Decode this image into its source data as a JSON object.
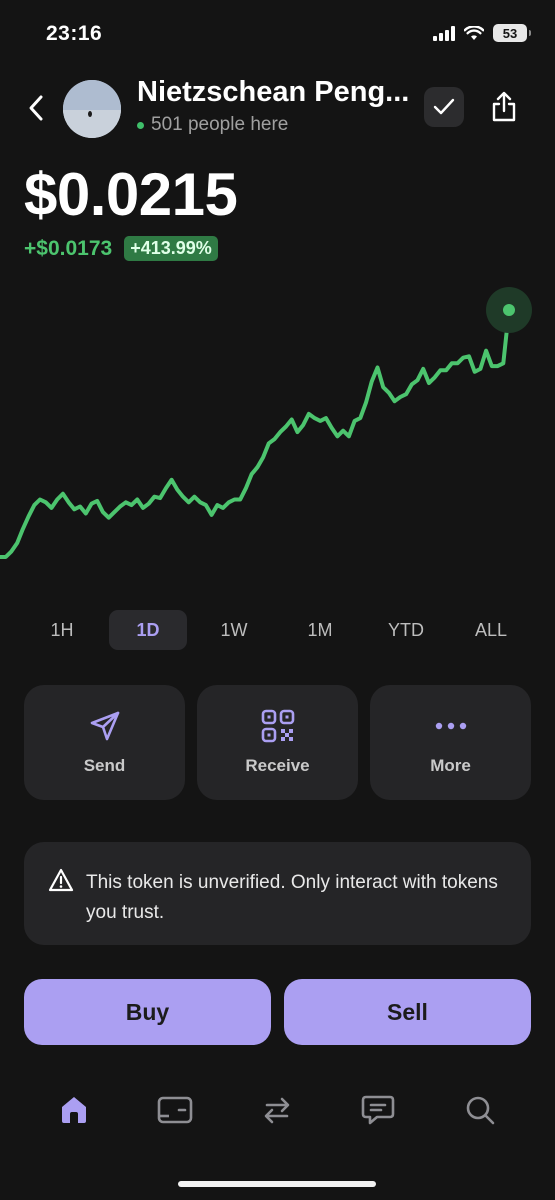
{
  "status_bar": {
    "time": "23:16",
    "battery": "53"
  },
  "token": {
    "name": "Nietzschean Peng...",
    "holders": "501 people here"
  },
  "price": {
    "value": "$0.0215",
    "change_abs": "+$0.0173",
    "change_pct": "+413.99%"
  },
  "colors": {
    "accent": "#ab9ff2",
    "positive": "#4cc46e",
    "background": "#141414",
    "card": "#252527"
  },
  "chart_data": {
    "type": "line",
    "series": [
      {
        "values": [
          0.0042,
          0.0042,
          0.0046,
          0.0052,
          0.0062,
          0.0071,
          0.0079,
          0.0083,
          0.0081,
          0.0077,
          0.0083,
          0.0087,
          0.0081,
          0.0076,
          0.0078,
          0.0073,
          0.008,
          0.0082,
          0.0074,
          0.007,
          0.0074,
          0.0078,
          0.0081,
          0.0079,
          0.0083,
          0.0077,
          0.008,
          0.0085,
          0.0084,
          0.0091,
          0.0097,
          0.009,
          0.0085,
          0.0081,
          0.0085,
          0.0081,
          0.0079,
          0.0072,
          0.0079,
          0.0077,
          0.0081,
          0.0083,
          0.0083,
          0.0091,
          0.0101,
          0.0106,
          0.0113,
          0.0123,
          0.0126,
          0.0131,
          0.0135,
          0.014,
          0.0131,
          0.0136,
          0.0144,
          0.0141,
          0.0139,
          0.0141,
          0.0134,
          0.0128,
          0.0132,
          0.0128,
          0.0139,
          0.0141,
          0.0152,
          0.0167,
          0.0177,
          0.0163,
          0.0159,
          0.0153,
          0.0156,
          0.0158,
          0.0165,
          0.0168,
          0.0176,
          0.0166,
          0.017,
          0.0175,
          0.0175,
          0.018,
          0.018,
          0.0184,
          0.0185,
          0.0174,
          0.0176,
          0.0189,
          0.0178,
          0.0178,
          0.018,
          0.0218
        ]
      }
    ]
  },
  "ranges": [
    "1H",
    "1D",
    "1W",
    "1M",
    "YTD",
    "ALL"
  ],
  "active_range": "1D",
  "actions": {
    "send": "Send",
    "receive": "Receive",
    "more": "More"
  },
  "warning": {
    "text": "This token is unverified. Only interact with tokens you trust."
  },
  "trade": {
    "buy": "Buy",
    "sell": "Sell"
  },
  "tabs": [
    "home-icon",
    "wallet-icon",
    "swap-icon",
    "chat-icon",
    "search-icon"
  ]
}
